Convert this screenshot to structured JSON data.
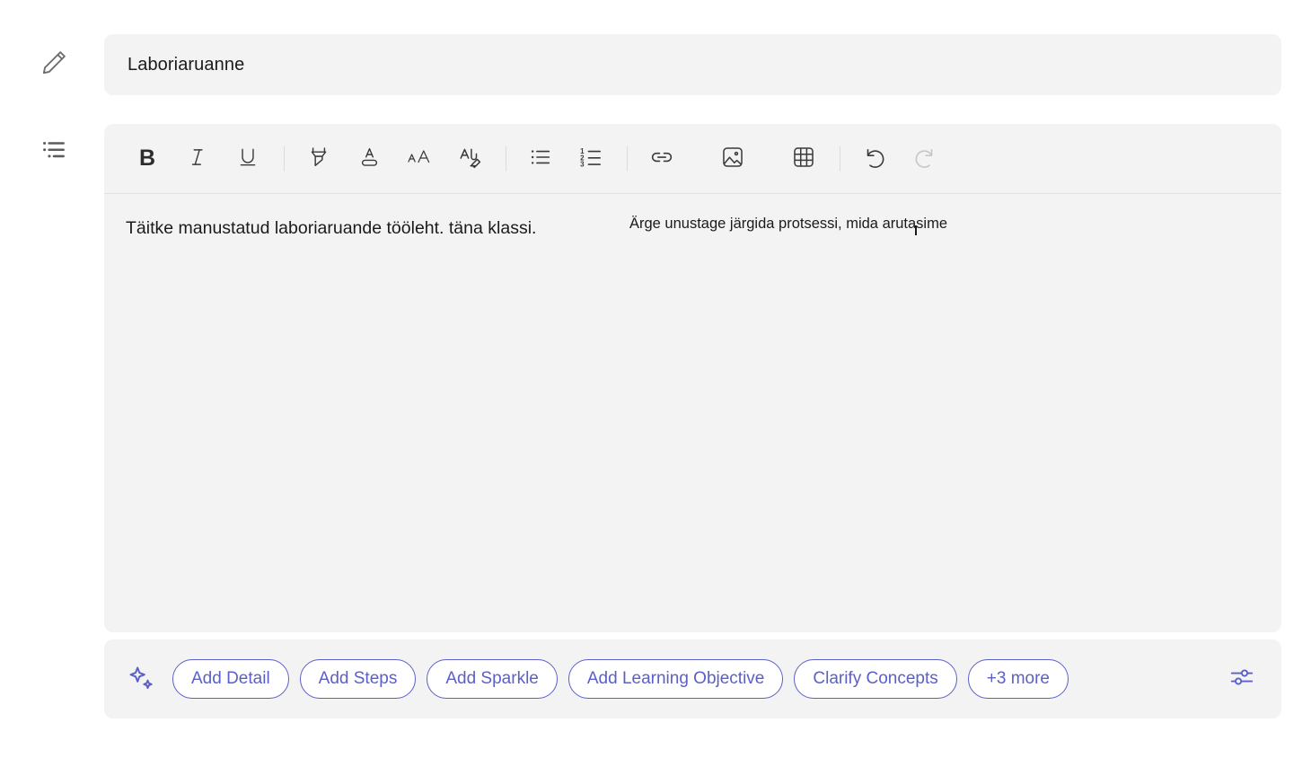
{
  "assignment": {
    "title_value": "Laboriaruanne",
    "title_placeholder": "Title",
    "edit_icon": "pencil-icon",
    "instructions_icon": "bulleted-list-icon"
  },
  "editor": {
    "toolbar": [
      {
        "name": "bold-button",
        "label": "B",
        "icon": "bold-icon",
        "disabled": false
      },
      {
        "name": "italic-button",
        "label": "",
        "icon": "italic-icon",
        "disabled": false
      },
      {
        "name": "underline-button",
        "label": "",
        "icon": "underline-icon",
        "disabled": false
      },
      {
        "name": "highlight-button",
        "label": "",
        "icon": "highlighter-icon",
        "disabled": false
      },
      {
        "name": "font-color-button",
        "label": "",
        "icon": "font-color-icon",
        "disabled": false
      },
      {
        "name": "font-size-button",
        "label": "",
        "icon": "font-size-icon",
        "disabled": false
      },
      {
        "name": "clear-formatting-button",
        "label": "",
        "icon": "clear-formatting-icon",
        "disabled": false
      },
      {
        "name": "bulleted-list-button",
        "label": "",
        "icon": "bulleted-list-icon",
        "disabled": false
      },
      {
        "name": "numbered-list-button",
        "label": "",
        "icon": "numbered-list-icon",
        "disabled": false
      },
      {
        "name": "insert-link-button",
        "label": "",
        "icon": "link-icon",
        "disabled": false
      },
      {
        "name": "insert-image-button",
        "label": "",
        "icon": "image-icon",
        "disabled": false
      },
      {
        "name": "insert-table-button",
        "label": "",
        "icon": "table-icon",
        "disabled": false
      },
      {
        "name": "undo-button",
        "label": "",
        "icon": "undo-icon",
        "disabled": false
      },
      {
        "name": "redo-button",
        "label": "",
        "icon": "redo-icon",
        "disabled": true
      }
    ],
    "body_paragraph_left": "Täitke manustatud laboriaruande tööleht. täna klassi.",
    "body_paragraph_right": "Ärge unustage järgida protsessi, mida arutasime"
  },
  "ai_bar": {
    "sparkle_icon": "sparkle-icon",
    "settings_icon": "sliders-settings-icon",
    "chips": [
      {
        "name": "chip-add-detail",
        "label": "Add Detail"
      },
      {
        "name": "chip-add-steps",
        "label": "Add Steps"
      },
      {
        "name": "chip-add-sparkle",
        "label": "Add Sparkle"
      },
      {
        "name": "chip-add-learning-objective",
        "label": "Add Learning Objective"
      },
      {
        "name": "chip-clarify-concepts",
        "label": "Clarify Concepts"
      },
      {
        "name": "chip-more",
        "label": "+3 more"
      }
    ]
  },
  "colors": {
    "accent": "#5b5fc7",
    "panel_bg": "#f3f3f3",
    "text": "#1b1b1b",
    "icon": "#3b3a39",
    "icon_disabled": "#c8c6c4"
  }
}
